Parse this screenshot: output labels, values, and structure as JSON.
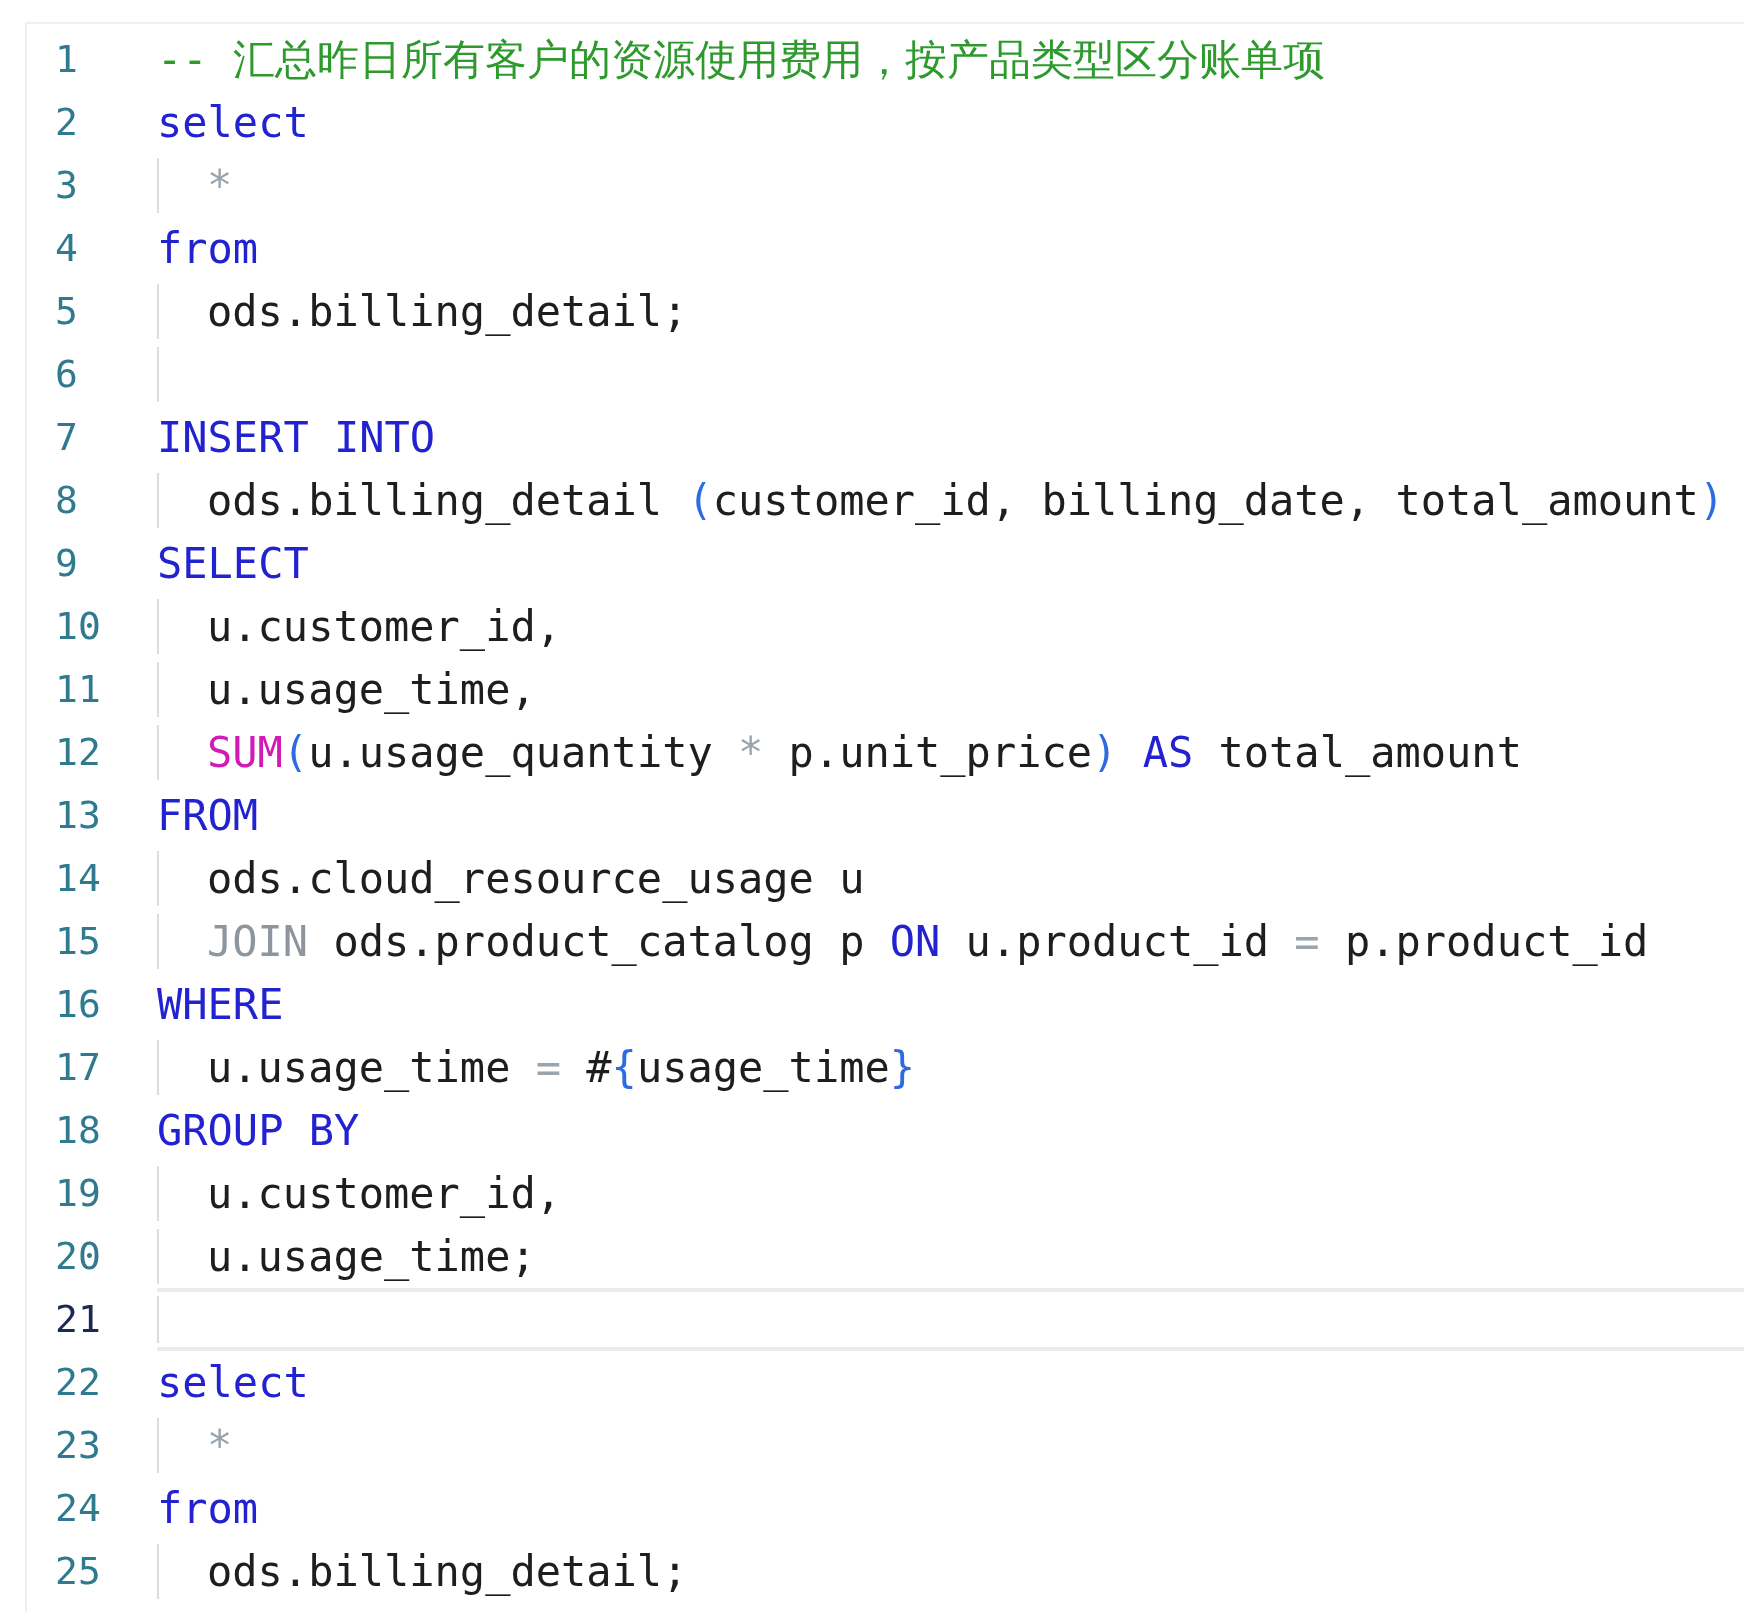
{
  "editor": {
    "lines": [
      {
        "number": "1",
        "indent": false,
        "current": false,
        "tokens": [
          {
            "kind": "comment",
            "text": "-- 汇总昨日所有客户的资源使用费用，按产品类型区分账单项"
          }
        ]
      },
      {
        "number": "2",
        "indent": false,
        "current": false,
        "tokens": [
          {
            "kind": "keyword",
            "text": "select"
          }
        ]
      },
      {
        "number": "3",
        "indent": true,
        "current": false,
        "tokens": [
          {
            "kind": "operator",
            "text": "*"
          }
        ]
      },
      {
        "number": "4",
        "indent": false,
        "current": false,
        "tokens": [
          {
            "kind": "keyword",
            "text": "from"
          }
        ]
      },
      {
        "number": "5",
        "indent": true,
        "current": false,
        "tokens": [
          {
            "kind": "plain",
            "text": "ods.billing_detail;"
          }
        ]
      },
      {
        "number": "6",
        "indent": true,
        "current": false
      },
      {
        "number": "7",
        "indent": false,
        "current": false,
        "tokens": [
          {
            "kind": "keyword",
            "text": "INSERT INTO"
          }
        ]
      },
      {
        "number": "8",
        "indent": true,
        "current": false,
        "tokens": [
          {
            "kind": "plain",
            "text": "ods.billing_detail "
          },
          {
            "kind": "bracket",
            "text": "("
          },
          {
            "kind": "plain",
            "text": "customer_id, billing_date, total_amount"
          },
          {
            "kind": "bracket",
            "text": ")"
          }
        ]
      },
      {
        "number": "9",
        "indent": false,
        "current": false,
        "tokens": [
          {
            "kind": "keyword",
            "text": "SELECT"
          }
        ]
      },
      {
        "number": "10",
        "indent": true,
        "current": false,
        "tokens": [
          {
            "kind": "plain",
            "text": "u.customer_id,"
          }
        ]
      },
      {
        "number": "11",
        "indent": true,
        "current": false,
        "tokens": [
          {
            "kind": "plain",
            "text": "u.usage_time,"
          }
        ]
      },
      {
        "number": "12",
        "indent": true,
        "current": false,
        "tokens": [
          {
            "kind": "function",
            "text": "SUM"
          },
          {
            "kind": "bracket",
            "text": "("
          },
          {
            "kind": "plain",
            "text": "u.usage_quantity "
          },
          {
            "kind": "operator",
            "text": "*"
          },
          {
            "kind": "plain",
            "text": " p.unit_price"
          },
          {
            "kind": "bracket",
            "text": ") "
          },
          {
            "kind": "keyword",
            "text": "AS"
          },
          {
            "kind": "plain",
            "text": " total_amount"
          }
        ]
      },
      {
        "number": "13",
        "indent": false,
        "current": false,
        "tokens": [
          {
            "kind": "keyword",
            "text": "FROM"
          }
        ]
      },
      {
        "number": "14",
        "indent": true,
        "current": false,
        "tokens": [
          {
            "kind": "plain",
            "text": "ods.cloud_resource_usage u"
          }
        ]
      },
      {
        "number": "15",
        "indent": true,
        "current": false,
        "tokens": [
          {
            "kind": "muted",
            "text": "JOIN"
          },
          {
            "kind": "plain",
            "text": " ods.product_catalog p "
          },
          {
            "kind": "keyword",
            "text": "ON"
          },
          {
            "kind": "plain",
            "text": " u.product_id "
          },
          {
            "kind": "operator",
            "text": "="
          },
          {
            "kind": "plain",
            "text": " p.product_id"
          }
        ]
      },
      {
        "number": "16",
        "indent": false,
        "current": false,
        "tokens": [
          {
            "kind": "keyword",
            "text": "WHERE"
          }
        ]
      },
      {
        "number": "17",
        "indent": true,
        "current": false,
        "tokens": [
          {
            "kind": "plain",
            "text": "u.usage_time "
          },
          {
            "kind": "operator",
            "text": "="
          },
          {
            "kind": "plain",
            "text": " #"
          },
          {
            "kind": "bracket",
            "text": "{"
          },
          {
            "kind": "plain",
            "text": "usage_time"
          },
          {
            "kind": "bracket",
            "text": "}"
          }
        ]
      },
      {
        "number": "18",
        "indent": false,
        "current": false,
        "tokens": [
          {
            "kind": "keyword",
            "text": "GROUP BY"
          }
        ]
      },
      {
        "number": "19",
        "indent": true,
        "current": false,
        "tokens": [
          {
            "kind": "plain",
            "text": "u.customer_id,"
          }
        ]
      },
      {
        "number": "20",
        "indent": true,
        "current": false,
        "tokens": [
          {
            "kind": "plain",
            "text": "u.usage_time;"
          }
        ]
      },
      {
        "number": "21",
        "indent": true,
        "current": true
      },
      {
        "number": "22",
        "indent": false,
        "current": false,
        "tokens": [
          {
            "kind": "keyword",
            "text": "select"
          }
        ]
      },
      {
        "number": "23",
        "indent": true,
        "current": false,
        "tokens": [
          {
            "kind": "operator",
            "text": "*"
          }
        ]
      },
      {
        "number": "24",
        "indent": false,
        "current": false,
        "tokens": [
          {
            "kind": "keyword",
            "text": "from"
          }
        ]
      },
      {
        "number": "25",
        "indent": true,
        "current": false,
        "tokens": [
          {
            "kind": "plain",
            "text": "ods.billing_detail;"
          }
        ]
      }
    ]
  }
}
